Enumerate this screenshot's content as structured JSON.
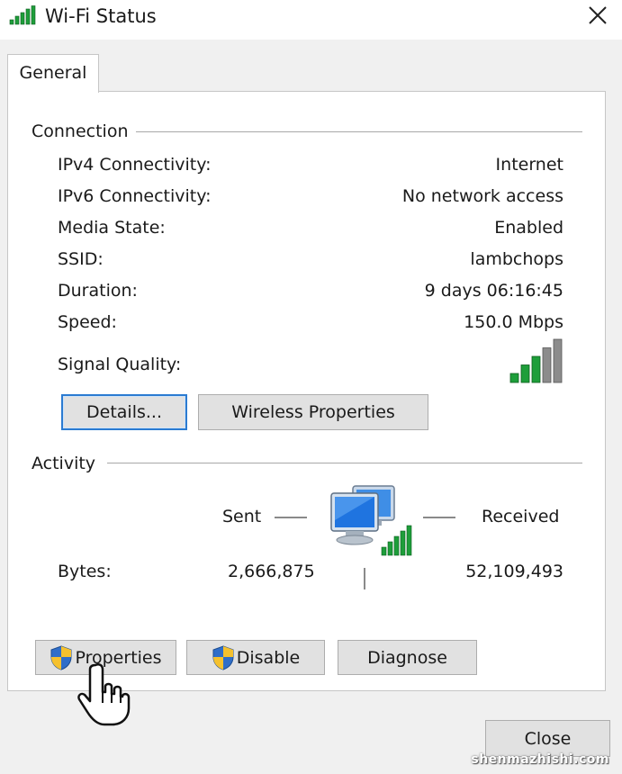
{
  "window": {
    "title": "Wi-Fi Status"
  },
  "tabs": [
    {
      "label": "General"
    }
  ],
  "connection": {
    "title": "Connection",
    "rows": [
      {
        "label": "IPv4 Connectivity:",
        "value": "Internet"
      },
      {
        "label": "IPv6 Connectivity:",
        "value": "No network access"
      },
      {
        "label": "Media State:",
        "value": "Enabled"
      },
      {
        "label": "SSID:",
        "value": "lambchops"
      },
      {
        "label": "Duration:",
        "value": "9 days 06:16:45"
      },
      {
        "label": "Speed:",
        "value": "150.0 Mbps"
      }
    ],
    "signal_label": "Signal Quality:",
    "signal_bars_filled": 3,
    "signal_bars_total": 5,
    "details_button": "Details...",
    "wireless_button": "Wireless Properties"
  },
  "activity": {
    "title": "Activity",
    "sent_label": "Sent",
    "received_label": "Received",
    "bytes_label": "Bytes:",
    "bytes_sent": "2,666,875",
    "bytes_received": "52,109,493"
  },
  "buttons": {
    "properties": "Properties",
    "disable": "Disable",
    "diagnose": "Diagnose",
    "close": "Close"
  },
  "watermark": "shenmazhishi.com",
  "colors": {
    "signal_on": "#1e9e3a",
    "signal_off": "#8c8c8c",
    "default_button_border": "#2b7bd1",
    "shield_blue": "#2f6ec9",
    "shield_yellow": "#f5c12e"
  },
  "icons": {
    "title": "wifi-signal-icon",
    "close": "close-icon",
    "network": "network-computers-icon",
    "shield": "uac-shield-icon",
    "cursor": "hand-pointer-icon"
  }
}
